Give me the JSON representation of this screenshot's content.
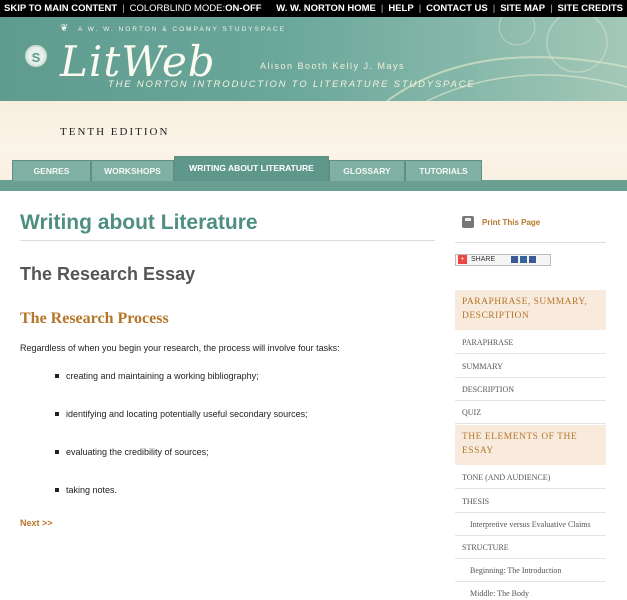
{
  "topbar": {
    "skip_label": "SKIP TO MAIN CONTENT",
    "colorblind_label": "COLORBLIND MODE:",
    "colorblind_state": "ON-OFF",
    "links": [
      "W. W. NORTON HOME",
      "HELP",
      "CONTACT US",
      "SITE MAP",
      "SITE CREDITS"
    ]
  },
  "banner": {
    "publisher": "A W. W. NORTON & COMPANY STUDYSPACE",
    "logo_letter": "S",
    "brand": "LitWeb",
    "authors": "Alison Booth   Kelly J. Mays",
    "subtitle": "THE NORTON INTRODUCTION TO LITERATURE STUDYSPACE",
    "edition": "TENTH EDITION"
  },
  "nav": {
    "tabs": [
      {
        "label": "GENRES",
        "active": false
      },
      {
        "label": "WORKSHOPS",
        "active": false
      },
      {
        "label": "WRITING ABOUT LITERATURE",
        "active": true
      },
      {
        "label": "GLOSSARY",
        "active": false
      },
      {
        "label": "TUTORIALS",
        "active": false
      }
    ]
  },
  "main": {
    "title": "Writing about Literature",
    "section": "The Research Essay",
    "subsection": "The Research Process",
    "intro": "Regardless of when you begin your research, the process will involve four tasks:",
    "tasks": [
      "creating and maintaining a working bibliography;",
      "identifying and locating potentially useful secondary sources;",
      "evaluating the credibility of sources;",
      "taking notes."
    ],
    "next_label": "Next >>"
  },
  "sidebar": {
    "print_label": "Print This Page",
    "share_label": "SHARE",
    "groups": [
      {
        "heading": "PARAPHRASE, SUMMARY, DESCRIPTION",
        "items": [
          "PARAPHRASE",
          "SUMMARY",
          "DESCRIPTION",
          "QUIZ"
        ]
      },
      {
        "heading": "THE ELEMENTS OF THE ESSAY",
        "items": [
          "TONE (AND AUDIENCE)",
          "THESIS",
          "Interpretive versus Evaluative Claims",
          "STRUCTURE",
          "Beginning: The Introduction",
          "Middle: The Body"
        ]
      }
    ]
  },
  "colors": {
    "brand_teal": "#5f9c8f",
    "accent_brown": "#b5762a",
    "sidebar_heading_bg": "#f8ebdd"
  }
}
